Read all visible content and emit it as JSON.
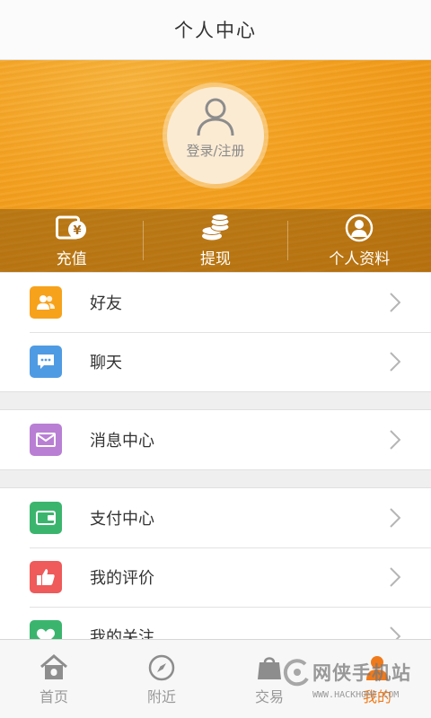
{
  "header": {
    "title": "个人中心"
  },
  "profile": {
    "login_label": "登录/注册",
    "avatar_icon": "user-icon"
  },
  "quick_actions": [
    {
      "label": "充值",
      "icon": "wallet-yen-icon"
    },
    {
      "label": "提现",
      "icon": "coins-icon"
    },
    {
      "label": "个人资料",
      "icon": "user-circle-icon"
    }
  ],
  "menu_groups": [
    [
      {
        "label": "好友",
        "icon": "friend-icon",
        "color": "#f7a21b"
      },
      {
        "label": "聊天",
        "icon": "chat-icon",
        "color": "#4f9be3"
      }
    ],
    [
      {
        "label": "消息中心",
        "icon": "mail-icon",
        "color": "#b97fd4"
      }
    ],
    [
      {
        "label": "支付中心",
        "icon": "wallet-icon",
        "color": "#3bb56e"
      },
      {
        "label": "我的评价",
        "icon": "thumbs-up-icon",
        "color": "#ef5a5a"
      },
      {
        "label": "我的关注",
        "icon": "heart-icon",
        "color": "#3bb56e"
      }
    ]
  ],
  "tabbar": [
    {
      "label": "首页",
      "icon": "home-icon",
      "active": false
    },
    {
      "label": "附近",
      "icon": "compass-icon",
      "active": false
    },
    {
      "label": "交易",
      "icon": "bag-icon",
      "active": false
    },
    {
      "label": "我的",
      "icon": "user-icon",
      "active": true
    }
  ],
  "watermark": {
    "text": "网侠手机站",
    "url": "WWW.HACKHOME.COM"
  },
  "colors": {
    "accent": "#f07a1a",
    "hero": "#f3a01e"
  }
}
